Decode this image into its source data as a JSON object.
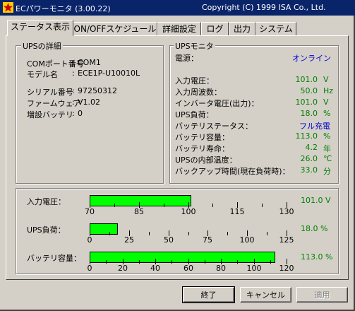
{
  "window": {
    "title": "ECパワーモニタ (3.00.22)",
    "copyright": "Copyright (C) 1999 ISA Co., Ltd."
  },
  "tabs": [
    {
      "label": "ステータス表示",
      "active": true
    },
    {
      "label": "ON/OFFスケジュール"
    },
    {
      "label": "詳細設定"
    },
    {
      "label": "ログ"
    },
    {
      "label": "出力"
    },
    {
      "label": "システム"
    }
  ],
  "details": {
    "title": "UPSの詳細",
    "rows": [
      {
        "label": "COMポート番号",
        "value": "COM1"
      },
      {
        "label": "モデル名",
        "value": "ECE1P-U10010L"
      },
      {
        "label": "シリアル番号",
        "value": "97250312"
      },
      {
        "label": "ファームウェア",
        "value": "V1.02"
      },
      {
        "label": "増設バッテリ",
        "value": "0"
      }
    ]
  },
  "monitor": {
    "title": "UPSモニタ",
    "power_label": "電源：",
    "power_value": "オンライン",
    "rows": [
      {
        "label": "入力電圧：",
        "value": "101.0",
        "unit": "V"
      },
      {
        "label": "入力周波数：",
        "value": "50.0",
        "unit": "Hz"
      },
      {
        "label": "インバータ電圧(出力)：",
        "value": "101.0",
        "unit": "V"
      },
      {
        "label": "UPS負荷：",
        "value": "18.0",
        "unit": "%"
      },
      {
        "label": "バッテリステータス：",
        "value": "フル充電",
        "unit": ""
      },
      {
        "label": "バッテリ容量：",
        "value": "113.0",
        "unit": "%"
      },
      {
        "label": "バッテリ寿命：",
        "value": "4.2",
        "unit": "年"
      },
      {
        "label": "UPSの内部温度：",
        "value": "26.0",
        "unit": "℃"
      },
      {
        "label": "バックアップ時間(現在負荷時)：",
        "value": "33.0",
        "unit": "分"
      }
    ]
  },
  "bars": [
    {
      "label": "入力電圧：",
      "value_text": "101.0 V",
      "value": 101.0,
      "min": 70,
      "max": 130,
      "ticks": [
        "70",
        "85",
        "100",
        "115",
        "130"
      ]
    },
    {
      "label": "UPS負荷：",
      "value_text": "18.0 %",
      "value": 18.0,
      "min": 0,
      "max": 125,
      "ticks": [
        "0",
        "25",
        "50",
        "75",
        "100",
        "125"
      ]
    },
    {
      "label": "バッテリ容量：",
      "value_text": "113.0 %",
      "value": 113.0,
      "min": 0,
      "max": 120,
      "ticks": [
        "0",
        "20",
        "40",
        "60",
        "80",
        "100",
        "120"
      ]
    }
  ],
  "buttons": {
    "ok": "終了",
    "cancel": "キャンセル",
    "apply": "適用"
  },
  "colors": {
    "titlebar": "#0a246a",
    "bar_fill": "#00ff00",
    "value_text": "#008000",
    "status_text": "#0000cc"
  }
}
